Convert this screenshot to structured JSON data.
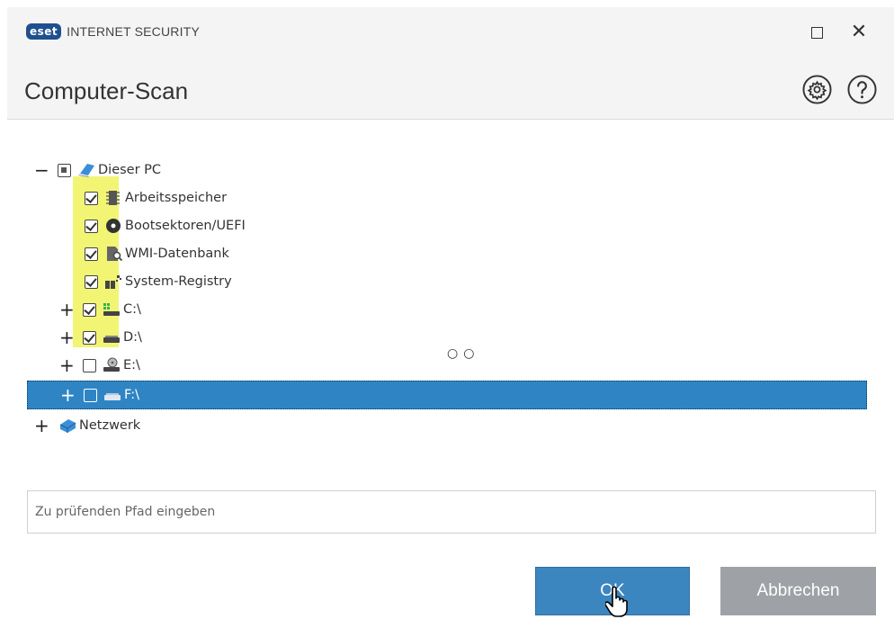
{
  "window": {
    "logo_badge": "eset",
    "product_name": "INTERNET SECURITY",
    "maximize_symbol": "",
    "close_symbol": "✕"
  },
  "header": {
    "title": "Computer-Scan",
    "icons": [
      "gear-icon",
      "help-icon"
    ]
  },
  "tree": {
    "items": [
      {
        "toggle": "−",
        "state": "partial",
        "icon": "computer-icon",
        "label": "Dieser PC"
      },
      {
        "toggle": "",
        "state": "checked",
        "icon": "memory-chip-icon",
        "label": "Arbeitsspeicher"
      },
      {
        "toggle": "",
        "state": "checked",
        "icon": "disc-icon",
        "label": "Bootsektoren/UEFI"
      },
      {
        "toggle": "",
        "state": "checked",
        "icon": "document-search-icon",
        "label": "WMI-Datenbank"
      },
      {
        "toggle": "",
        "state": "checked",
        "icon": "registry-icon",
        "label": "System-Registry"
      },
      {
        "toggle": "+",
        "state": "checked",
        "icon": "system-drive-icon",
        "label": "C:\\"
      },
      {
        "toggle": "+",
        "state": "checked",
        "icon": "drive-icon",
        "label": "D:\\"
      },
      {
        "toggle": "+",
        "state": "unchecked",
        "icon": "optical-drive-icon",
        "label": "E:\\"
      },
      {
        "toggle": "+",
        "state": "unchecked",
        "icon": "drive-icon",
        "label": "F:\\",
        "selected": true
      },
      {
        "toggle": "+",
        "state": "none",
        "icon": "network-icon",
        "label": "Netzwerk"
      }
    ]
  },
  "cursor_text": "○○",
  "path_input": {
    "placeholder": "Zu prüfenden Pfad eingeben",
    "value": ""
  },
  "buttons": {
    "ok_label": "OK",
    "cancel_label": "Abbrechen"
  },
  "colors": {
    "accent": "#2f85c4",
    "ok_button": "#3c86c0",
    "cancel_button": "#9ea2a6",
    "highlight": "#eef35a"
  }
}
